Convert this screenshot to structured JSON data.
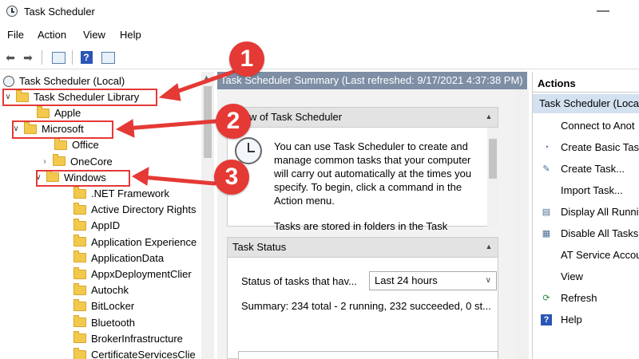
{
  "window": {
    "title": "Task Scheduler"
  },
  "menu": [
    "File",
    "Action",
    "View",
    "Help"
  ],
  "tree": {
    "root": "Task Scheduler (Local)",
    "library": "Task Scheduler Library",
    "items": [
      {
        "label": "Apple",
        "level": 2
      },
      {
        "label": "Microsoft",
        "level": 1
      },
      {
        "label": "Office",
        "level": 3
      },
      {
        "label": "OneCore",
        "level": 3
      },
      {
        "label": "Windows",
        "level": 2
      },
      {
        "label": ".NET Framework",
        "level": 4
      },
      {
        "label": "Active Directory Rights",
        "level": 4
      },
      {
        "label": "AppID",
        "level": 4
      },
      {
        "label": "Application Experience",
        "level": 4
      },
      {
        "label": "ApplicationData",
        "level": 4
      },
      {
        "label": "AppxDeploymentClier",
        "level": 4
      },
      {
        "label": "Autochk",
        "level": 4
      },
      {
        "label": "BitLocker",
        "level": 4
      },
      {
        "label": "Bluetooth",
        "level": 4
      },
      {
        "label": "BrokerInfrastructure",
        "level": 4
      },
      {
        "label": "CertificateServicesClie",
        "level": 4
      }
    ]
  },
  "center": {
    "header": "Task Scheduler Summary (Last refreshed: 9/17/2021 4:37:38 PM)",
    "overview_title": "rview of Task Scheduler",
    "overview_text": "You can use Task Scheduler to create and manage common tasks that your computer will carry out automatically at the times you specify. To begin, click a command in the Action menu.",
    "overview_text2": "Tasks are stored in folders in the Task",
    "status_title": "Task Status",
    "status_label": "Status of tasks that hav...",
    "status_range": "Last 24 hours",
    "summary": "Summary: 234 total - 2 running, 232 succeeded, 0 st..."
  },
  "actions": {
    "header": "Actions",
    "sub": "Task Scheduler (Local",
    "items": [
      {
        "label": "Connect to Anot",
        "icon": ""
      },
      {
        "label": "Create Basic Task",
        "icon": "create-basic-task-icon"
      },
      {
        "label": "Create Task...",
        "icon": "create-task-icon"
      },
      {
        "label": "Import Task...",
        "icon": ""
      },
      {
        "label": "Display All Runni",
        "icon": "display-running-icon"
      },
      {
        "label": "Disable All Tasks",
        "icon": "disable-tasks-icon"
      },
      {
        "label": "AT Service Accou",
        "icon": ""
      },
      {
        "label": "View",
        "icon": ""
      },
      {
        "label": "Refresh",
        "icon": "refresh-icon"
      },
      {
        "label": "Help",
        "icon": "help-icon"
      }
    ]
  },
  "callouts": [
    "1",
    "2",
    "3"
  ],
  "colors": {
    "accent": "#e53935",
    "header": "#7d8ea5",
    "selection": "#d3e1f1"
  }
}
